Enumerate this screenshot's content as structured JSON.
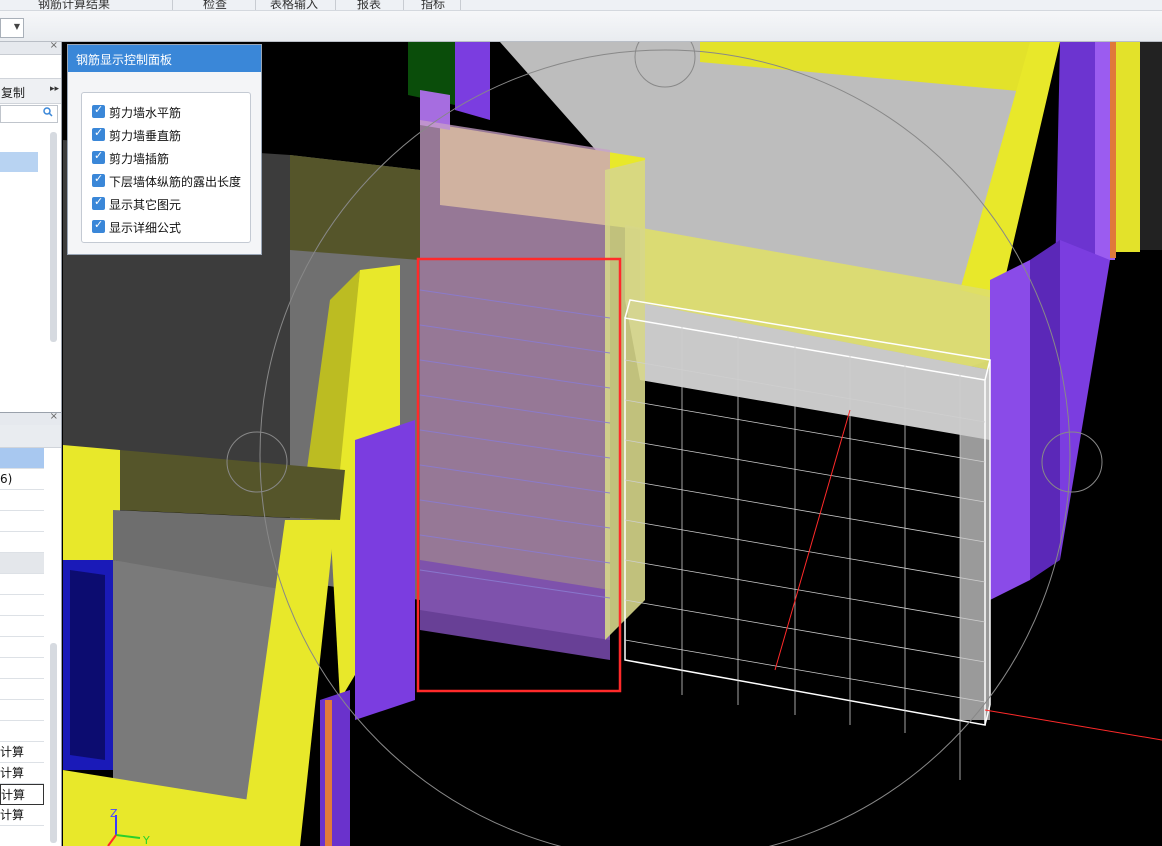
{
  "menu": {
    "items": [
      "钢筋计算结果",
      "检查",
      "表格输入",
      "报表",
      "指标"
    ]
  },
  "left_panel": {
    "copy_label": "复制",
    "more_icon": "double-chevron-right-icon",
    "search_icon": "search-icon",
    "close_icon": "close-icon",
    "list_items": [
      "6)",
      "",
      "",
      "",
      "",
      "",
      "",
      "",
      "",
      "",
      "",
      "计算",
      "计算",
      "计算",
      "计算"
    ]
  },
  "control_panel": {
    "title": "钢筋显示控制面板",
    "options": [
      {
        "label": "剪力墙水平筋",
        "checked": true
      },
      {
        "label": "剪力墙垂直筋",
        "checked": true
      },
      {
        "label": "剪力墙插筋",
        "checked": true
      },
      {
        "label": "下层墙体纵筋的露出长度",
        "checked": true
      },
      {
        "label": "显示其它图元",
        "checked": true
      },
      {
        "label": "显示详细公式",
        "checked": true
      }
    ]
  },
  "axis_labels": {
    "z": "Z",
    "y": "Y"
  },
  "colors": {
    "wall_yellow": "#e8e82a",
    "wall_purple": "#7a3be0",
    "wall_gray": "#8a8a8a",
    "rebar_highlight": "#ff2a2a",
    "panel_title": "#3a87d8"
  }
}
